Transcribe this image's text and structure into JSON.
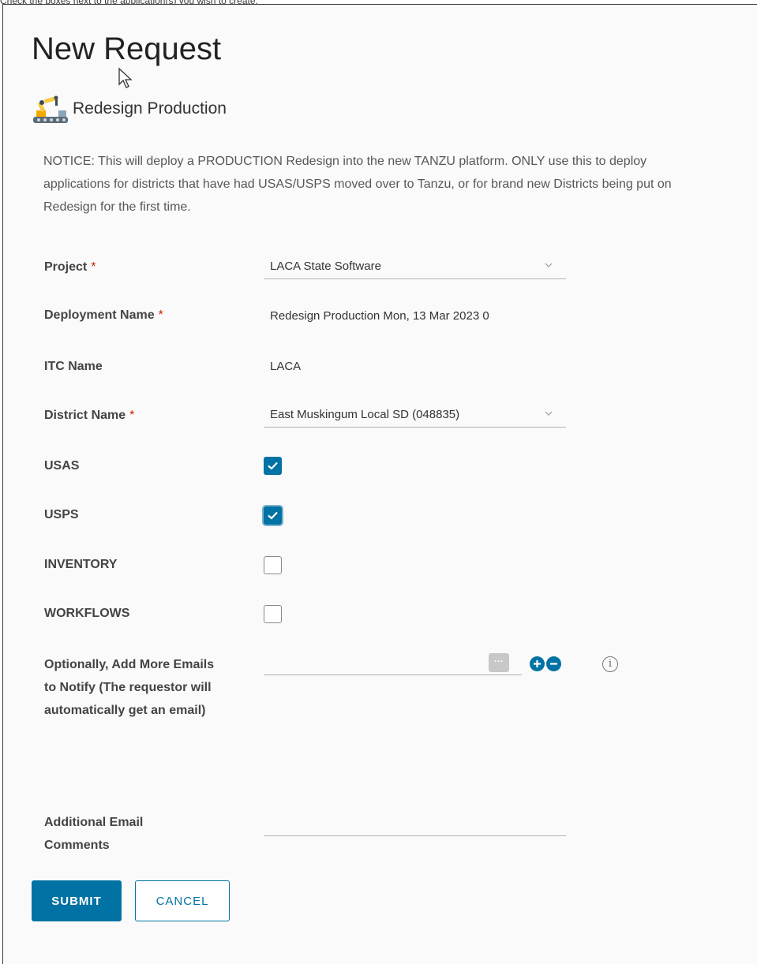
{
  "hint": "Check the boxes next to the application(s) you wish to create.",
  "form": {
    "title": "New Request",
    "catalog_item": "Redesign Production",
    "notice": "NOTICE: This will deploy a PRODUCTION Redesign into the new TANZU platform. ONLY use this to deploy applications for districts that have had USAS/USPS moved over to Tanzu, or for brand new Districts being put on Redesign for the first time.",
    "required_marker": "*",
    "fields": {
      "project": {
        "label": "Project",
        "value": "LACA State Software"
      },
      "deployment_name": {
        "label": "Deployment Name",
        "value": "Redesign Production Mon, 13 Mar 2023 0"
      },
      "itc_name": {
        "label": "ITC Name",
        "value": "LACA"
      },
      "district_name": {
        "label": "District Name",
        "value": "East Muskingum Local SD (048835)"
      },
      "usas": {
        "label": "USAS",
        "checked": true
      },
      "usps": {
        "label": "USPS",
        "checked": true
      },
      "inventory": {
        "label": "INVENTORY",
        "checked": false
      },
      "workflows": {
        "label": "WORKFLOWS",
        "checked": false
      },
      "emails": {
        "label": "Optionally, Add More Emails to Notify (The requestor will automatically get an email)",
        "value": ""
      },
      "comments": {
        "label": "Additional Email Comments",
        "value": ""
      }
    },
    "buttons": {
      "submit": "SUBMIT",
      "cancel": "CANCEL"
    }
  },
  "icons": {
    "catalog": "robot-arm-icon",
    "dropdown": "chevron-down-icon",
    "check": "checkmark-icon",
    "more": "ellipsis-icon",
    "add": "plus-circle-icon",
    "remove": "minus-circle-icon",
    "info": "info-icon"
  },
  "colors": {
    "primary": "#0072a3",
    "required": "#c92100"
  }
}
